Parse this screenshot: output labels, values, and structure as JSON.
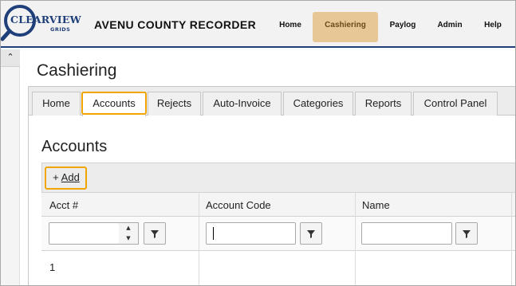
{
  "logo": {
    "name": "CLEARVIEW",
    "sub": "GRIDS"
  },
  "app_title": "AVENU COUNTY RECORDER",
  "nav": [
    "Home",
    "Cashiering",
    "Paylog",
    "Admin",
    "Help"
  ],
  "nav_active": "Cashiering",
  "collapse_icon": "chevron-up-icon",
  "page_title": "Cashiering",
  "tabs": [
    "Home",
    "Accounts",
    "Rejects",
    "Auto-Invoice",
    "Categories",
    "Reports",
    "Control Panel"
  ],
  "tab_active": "Accounts",
  "section_title": "Accounts",
  "toolbar": {
    "add_plus": "+",
    "add_label": "Add"
  },
  "grid": {
    "columns": [
      "Acct #",
      "Account Code",
      "Name"
    ],
    "filters": {
      "acct": "",
      "code": "",
      "name": ""
    },
    "rows": [
      [
        "1",
        "",
        ""
      ]
    ]
  },
  "colors": {
    "nav_border": "#1f3f7a",
    "active_nav": "#e7c795",
    "highlight": "#f0a500"
  }
}
